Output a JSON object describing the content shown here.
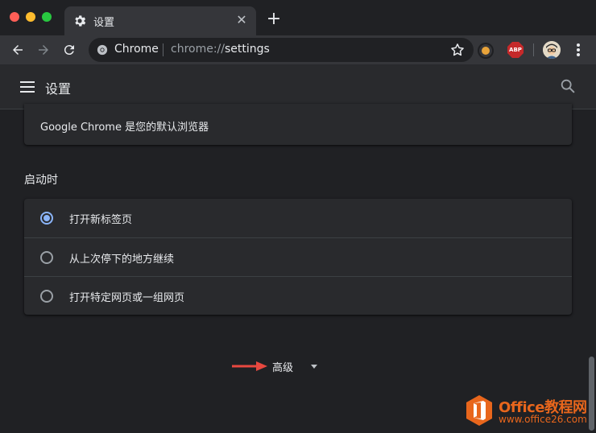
{
  "window": {
    "tab_title": "设置",
    "close_glyph": "✕",
    "new_tab_glyph": "+"
  },
  "toolbar": {
    "site_chip": "Chrome",
    "url_scheme": "chrome://",
    "url_host": "settings",
    "extension_abp": "ABP"
  },
  "settings_header": {
    "title": "设置"
  },
  "default_browser": {
    "text": "Google Chrome 是您的默认浏览器"
  },
  "on_startup": {
    "title": "启动时",
    "options": [
      {
        "label": "打开新标签页",
        "selected": true
      },
      {
        "label": "从上次停下的地方继续",
        "selected": false
      },
      {
        "label": "打开特定网页或一组网页",
        "selected": false
      }
    ]
  },
  "advanced": {
    "label": "高级"
  },
  "watermark": {
    "name": "Office教程网",
    "url": "www.office26.com"
  },
  "colors": {
    "accent": "#8ab4f8",
    "background": "#202124",
    "card": "#292a2d",
    "annotation_arrow": "#e8483f",
    "watermark": "#e8661c"
  },
  "icons": [
    "gear-icon",
    "back-icon",
    "forward-icon",
    "reload-icon",
    "star-icon",
    "hamburger-icon",
    "search-icon",
    "menu-dots-icon",
    "caret-down-icon"
  ]
}
